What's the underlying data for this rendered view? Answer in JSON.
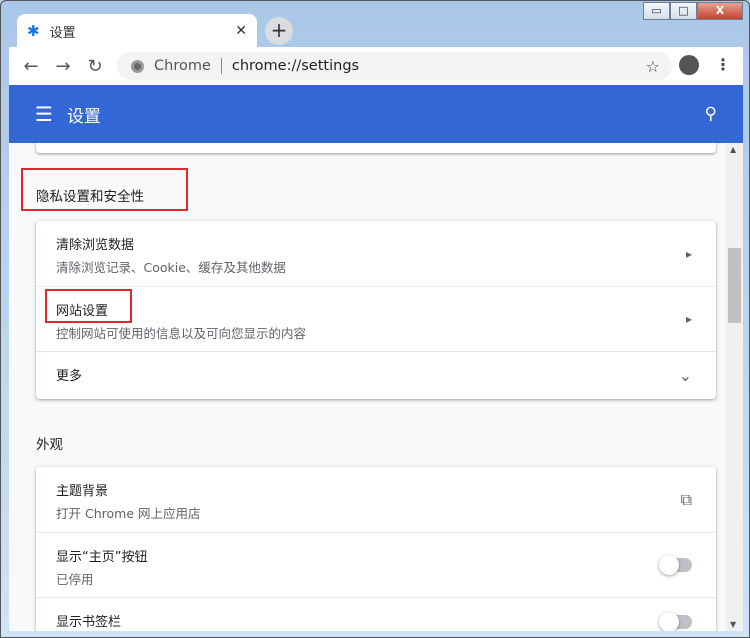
{
  "window": {
    "minimize": "▭",
    "maximize": "□",
    "close": "X"
  },
  "tab": {
    "title": "设置",
    "close": "✕",
    "new_tab": "+"
  },
  "toolbar": {
    "back": "←",
    "forward": "→",
    "reload": "↻",
    "site_label": "Chrome",
    "url": "chrome://settings",
    "star": "☆",
    "menu": "⋮"
  },
  "header": {
    "menu_icon": "☰",
    "title": "设置",
    "search_icon": "⚲"
  },
  "privacy": {
    "heading": "隐私设置和安全性",
    "items": [
      {
        "title": "清除浏览数据",
        "subtitle": "清除浏览记录、Cookie、缓存及其他数据",
        "action": "▸"
      },
      {
        "title": "网站设置",
        "subtitle": "控制网站可使用的信息以及可向您显示的内容",
        "action": "▸"
      },
      {
        "title": "更多",
        "action": "⌄"
      }
    ]
  },
  "appearance": {
    "heading": "外观",
    "items": [
      {
        "title": "主题背景",
        "subtitle": "打开 Chrome 网上应用店",
        "action": "⧉"
      },
      {
        "title": "显示“主页”按钮",
        "subtitle": "已停用",
        "toggle": false
      },
      {
        "title": "显示书签栏",
        "toggle": false
      }
    ]
  },
  "colors": {
    "accent": "#3367d6",
    "highlight": "#e0282e"
  }
}
